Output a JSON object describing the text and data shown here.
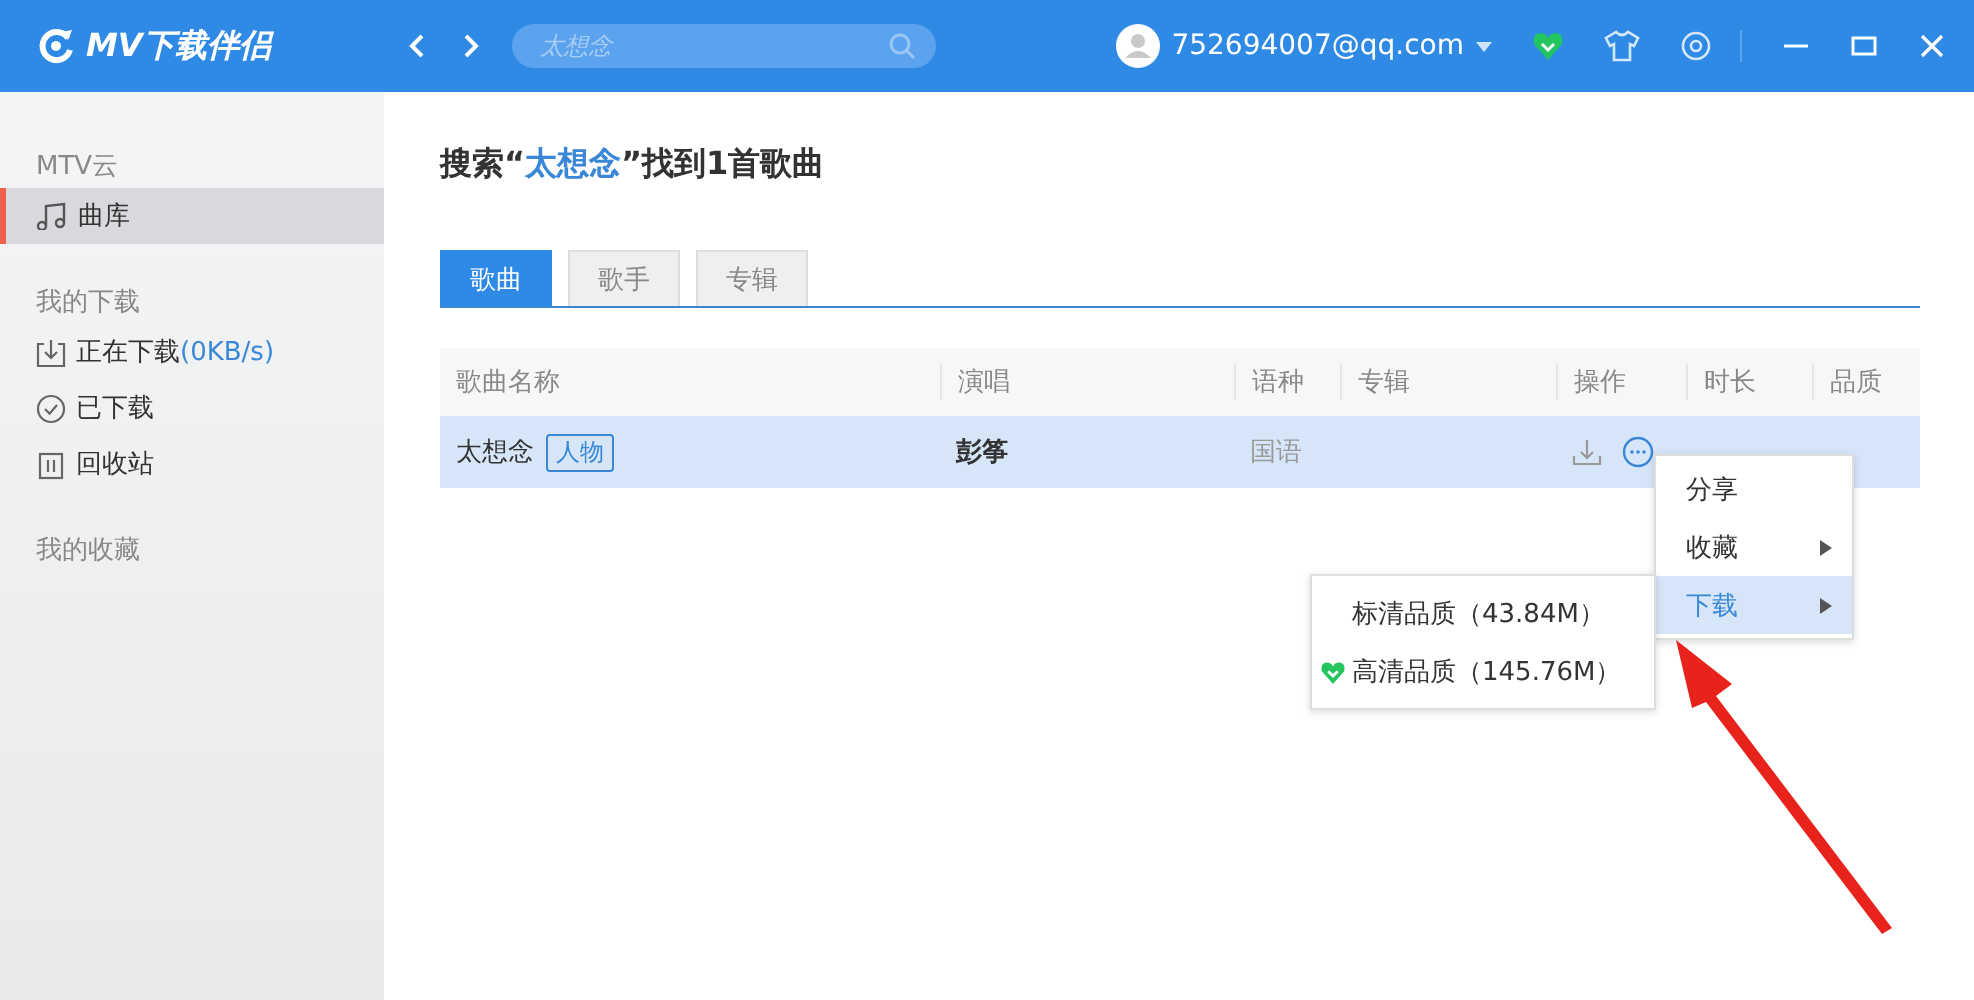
{
  "app": {
    "title": "MV下载伴侣"
  },
  "search": {
    "placeholder": "太想念"
  },
  "user": {
    "email": "752694007@qq.com"
  },
  "sidebar": [
    {
      "heading": "MTV云",
      "items": [
        {
          "label": "曲库",
          "kind": "music",
          "selected": true
        }
      ]
    },
    {
      "heading": "我的下载",
      "items": [
        {
          "label": "正在下载",
          "suffix": "(0KB/s)",
          "kind": "download",
          "selected": false
        },
        {
          "label": "已下载",
          "kind": "done",
          "selected": false
        },
        {
          "label": "回收站",
          "kind": "trash",
          "selected": false
        }
      ]
    },
    {
      "heading": "我的收藏"
    }
  ],
  "result": {
    "before": "搜索“",
    "query": "太想念",
    "after": "”找到1首歌曲"
  },
  "tabs": [
    {
      "label": "歌曲",
      "selected": true
    },
    {
      "label": "歌手",
      "selected": false
    },
    {
      "label": "专辑",
      "selected": false
    }
  ],
  "table": {
    "columns": [
      "歌曲名称",
      "演唱",
      "语种",
      "专辑",
      "操作",
      "时长",
      "品质"
    ],
    "rows": [
      {
        "title": "太想念",
        "tag": "人物",
        "artist": "彭筝",
        "language": "国语",
        "selected": true
      }
    ]
  },
  "menu": [
    {
      "label": "分享",
      "submenu": false,
      "selected": false
    },
    {
      "label": "收藏",
      "submenu": true,
      "selected": false
    },
    {
      "label": "下载",
      "submenu": true,
      "selected": true
    }
  ],
  "submenu": [
    {
      "label": "标清品质（43.84M）",
      "checked": false
    },
    {
      "label": "高清品质（145.76M）",
      "checked": true
    }
  ]
}
